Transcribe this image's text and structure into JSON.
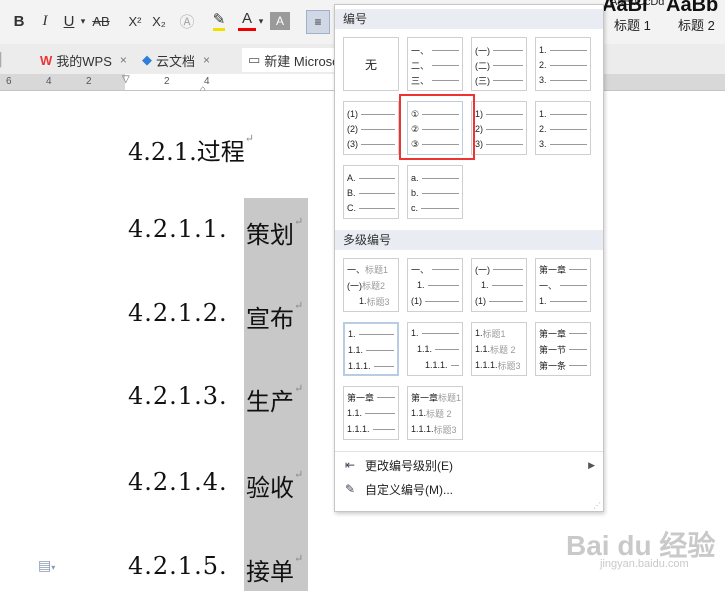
{
  "toolbar": {
    "bold": "B",
    "italic": "I",
    "underline": "U",
    "strike": "AB",
    "superscript": "X²",
    "subscript": "X₂",
    "font_color": "A",
    "style_name_1": "AaBbCcDd",
    "style_big_1": "AaBl",
    "style_big_2": "AaBb",
    "style_label_1": "标题 1",
    "style_label_2": "标题 2"
  },
  "tabs": [
    {
      "icon": "W",
      "label": "我的WPS"
    },
    {
      "icon": "◆",
      "label": "云文档"
    },
    {
      "icon": "▭",
      "label": "新建 Microso"
    }
  ],
  "ruler": {
    "left_nums": [
      "6",
      "4",
      "2",
      "2",
      "4"
    ]
  },
  "document": {
    "headings": [
      {
        "num": "4.2.1.",
        "text": "过程"
      },
      {
        "num": "4.2.1.1.",
        "text": "策划"
      },
      {
        "num": "4.2.1.2.",
        "text": "宣布"
      },
      {
        "num": "4.2.1.3.",
        "text": "生产"
      },
      {
        "num": "4.2.1.4.",
        "text": "验收"
      },
      {
        "num": "4.2.1.5.",
        "text": "接单"
      }
    ]
  },
  "numbering_popup": {
    "section_title": "编号",
    "none_label": "无",
    "single": [
      [
        "一、",
        "二、",
        "三、"
      ],
      [
        "(一)",
        "(二)",
        "(三)"
      ],
      [
        "1.",
        "2.",
        "3."
      ],
      [
        "(1)",
        "(2)",
        "(3)"
      ],
      [
        "①",
        "②",
        "③"
      ],
      [
        "1)",
        "2)",
        "3)"
      ],
      [
        "1.",
        "2.",
        "3."
      ],
      [
        "A.",
        "B.",
        "C."
      ],
      [
        "a.",
        "b.",
        "c."
      ]
    ],
    "multi_title": "多级编号",
    "multi": [
      [
        [
          "一、",
          "标题1"
        ],
        [
          "(一)",
          "标题2"
        ],
        [
          "1.",
          "标题3"
        ]
      ],
      [
        [
          "一、",
          ""
        ],
        [
          "1.",
          ""
        ],
        [
          "(1)",
          ""
        ]
      ],
      [
        [
          "(一)",
          ""
        ],
        [
          "1.",
          ""
        ],
        [
          "(1)",
          ""
        ]
      ],
      [
        [
          "第一章",
          ""
        ],
        [
          "一、",
          ""
        ],
        [
          "1.",
          ""
        ]
      ],
      [
        [
          "1.",
          ""
        ],
        [
          "1.1.",
          ""
        ],
        [
          "1.1.1.",
          ""
        ]
      ],
      [
        [
          "1.",
          ""
        ],
        [
          "1.1.",
          ""
        ],
        [
          "1.1.1.",
          ""
        ]
      ],
      [
        [
          "1.",
          "标题1"
        ],
        [
          "1.1.",
          "标题 2"
        ],
        [
          "1.1.1.",
          "标题3"
        ]
      ],
      [
        [
          "第一章",
          ""
        ],
        [
          "第一节",
          ""
        ],
        [
          "第一条",
          ""
        ]
      ],
      [
        [
          "第一章",
          ""
        ],
        [
          "1.1.",
          ""
        ],
        [
          "1.1.1.",
          ""
        ]
      ],
      [
        [
          "第一章",
          "标题1"
        ],
        [
          "1.1.",
          "标题 2"
        ],
        [
          "1.1.1.",
          "标题3"
        ]
      ]
    ],
    "menu_change_level": "更改编号级别(E)",
    "menu_custom": "自定义编号(M)..."
  },
  "watermark": {
    "brand": "Bai du 经验",
    "url": "jingyan.baidu.com"
  }
}
